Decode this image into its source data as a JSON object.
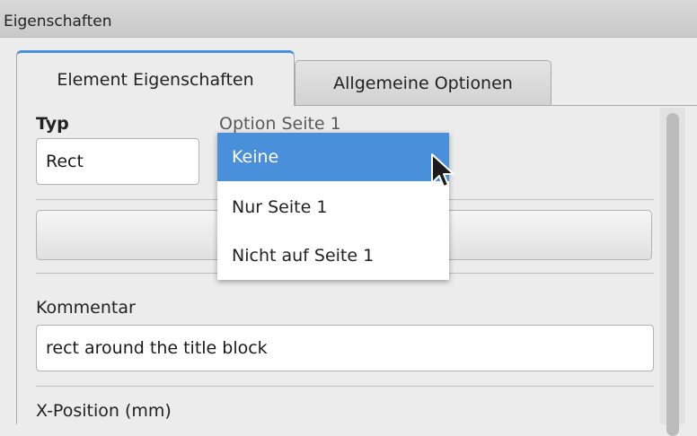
{
  "window": {
    "title": "Eigenschaften"
  },
  "tabs": [
    {
      "label": "Element Eigenschaften",
      "active": true
    },
    {
      "label": "Allgemeine Optionen",
      "active": false
    }
  ],
  "form": {
    "typ_label": "Typ",
    "typ_value": "Rect",
    "option_label": "Option Seite 1",
    "option_selected": "Keine",
    "kommentar_label": "Kommentar",
    "kommentar_value": "rect around the title block",
    "xpos_label": "X-Position (mm)"
  },
  "dropdown": {
    "options": [
      "Keine",
      "Nur Seite 1",
      "Nicht auf Seite 1"
    ],
    "highlighted": "Keine"
  },
  "colors": {
    "accent": "#4a8fd9",
    "tab_highlight": "#4a90d9"
  },
  "icons": {
    "pointer": "mouse-pointer-icon"
  }
}
